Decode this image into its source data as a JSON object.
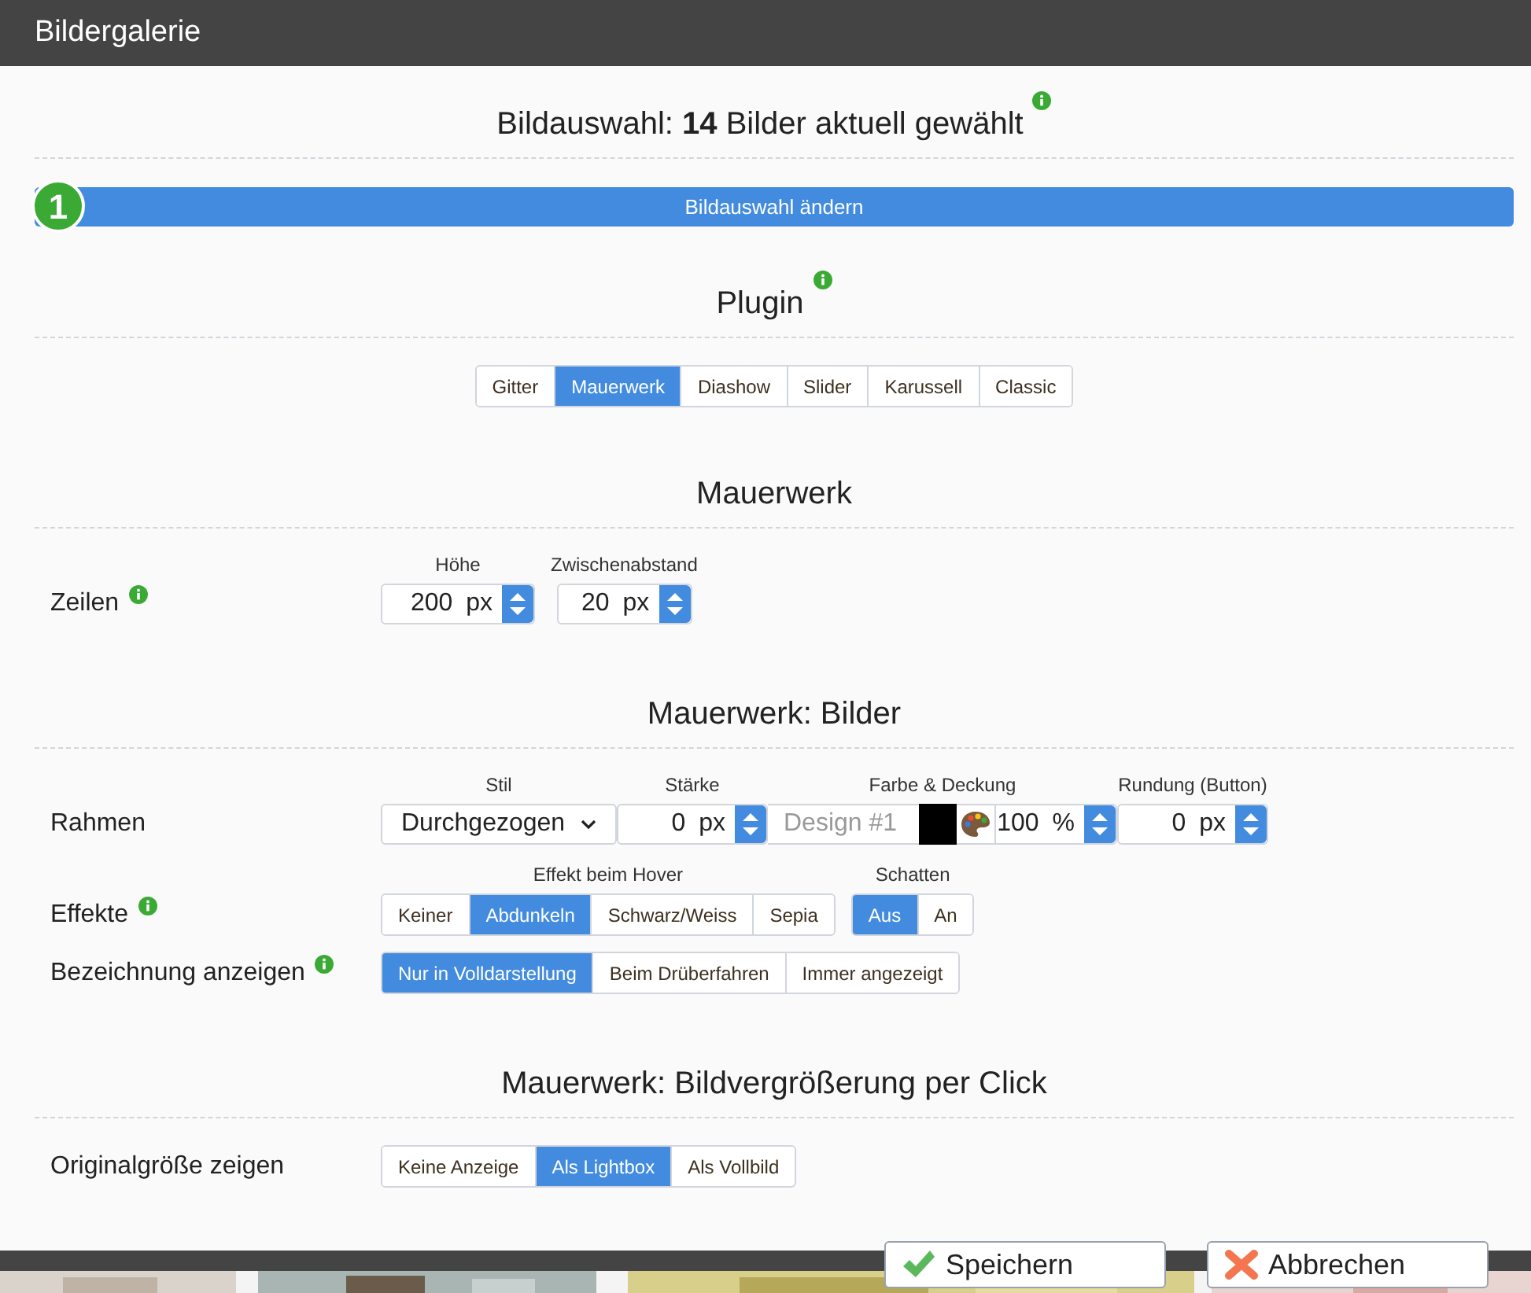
{
  "window": {
    "title": "Bildergalerie"
  },
  "selection": {
    "heading": "Bildauswahl: **14** Bilder aktuell gewählt",
    "info": true,
    "step": "1",
    "button": "Bildauswahl ändern"
  },
  "plugin": {
    "heading": "Plugin",
    "info": true,
    "options": [
      {
        "label": "Gitter",
        "selected": false
      },
      {
        "label": "Mauerwerk",
        "selected": true
      },
      {
        "label": "Diashow",
        "selected": false
      },
      {
        "label": "Slider",
        "selected": false
      },
      {
        "label": "Karussell",
        "selected": false
      },
      {
        "label": "Classic",
        "selected": false
      }
    ]
  },
  "sections": [
    {
      "heading": "Mauerwerk",
      "info": false,
      "rows": [
        {
          "label": "Zeilen",
          "info": true,
          "kind": "separate",
          "controls": [
            {
              "kind": "spinner",
              "caption": "Höhe",
              "value": "200",
              "unit": "px"
            },
            {
              "kind": "spinner",
              "caption": "Zwischenabstand",
              "value": "20",
              "unit": "px"
            }
          ]
        }
      ]
    },
    {
      "heading": "Mauerwerk: Bilder",
      "info": false,
      "rows": [
        {
          "label": "Rahmen",
          "info": false,
          "kind": "joined",
          "controls": [
            {
              "kind": "select",
              "caption": "Stil",
              "value": "Durchgezogen"
            },
            {
              "kind": "spinner",
              "caption": "Stärke",
              "value": "0",
              "unit": "px"
            },
            {
              "kind": "color",
              "caption": "Farbe & Deckung",
              "placeholder": "Design #1",
              "color": "#000000",
              "value": "100",
              "unit": "%"
            },
            {
              "kind": "spinner",
              "caption": "Rundung (Button)",
              "value": "0",
              "unit": "px"
            }
          ]
        },
        {
          "label": "Effekte",
          "info": true,
          "kind": "separate",
          "controls": [
            {
              "kind": "segmented",
              "caption": "Effekt beim Hover",
              "options": [
                {
                  "label": "Keiner",
                  "selected": false
                },
                {
                  "label": "Abdunkeln",
                  "selected": true
                },
                {
                  "label": "Schwarz/Weiss",
                  "selected": false
                },
                {
                  "label": "Sepia",
                  "selected": false
                }
              ]
            },
            {
              "kind": "segmented",
              "caption": "Schatten",
              "options": [
                {
                  "label": "Aus",
                  "selected": true
                },
                {
                  "label": "An",
                  "selected": false
                }
              ]
            }
          ]
        },
        {
          "label": "Bezeichnung anzeigen",
          "info": true,
          "kind": "separate",
          "controls": [
            {
              "kind": "segmented",
              "options": [
                {
                  "label": "Nur in Volldarstellung",
                  "selected": true
                },
                {
                  "label": "Beim Drüberfahren",
                  "selected": false
                },
                {
                  "label": "Immer angezeigt",
                  "selected": false
                }
              ]
            }
          ]
        }
      ]
    },
    {
      "heading": "Mauerwerk: Bildvergrößerung per Click",
      "info": false,
      "rows": [
        {
          "label": "Originalgröße zeigen",
          "info": false,
          "kind": "separate",
          "controls": [
            {
              "kind": "segmented",
              "options": [
                {
                  "label": "Keine Anzeige",
                  "selected": false
                },
                {
                  "label": "Als Lightbox",
                  "selected": true
                },
                {
                  "label": "Als Vollbild",
                  "selected": false
                }
              ]
            }
          ]
        }
      ]
    }
  ],
  "footer": {
    "buttons": [
      {
        "kind": "save",
        "label": "Speichern"
      },
      {
        "kind": "cancel",
        "label": "Abbrechen"
      }
    ]
  }
}
